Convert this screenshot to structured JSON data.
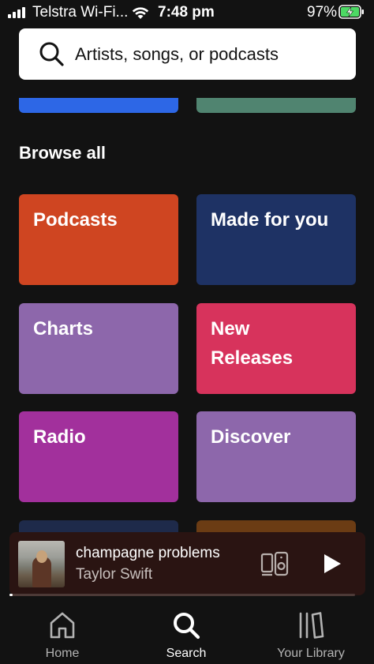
{
  "status_bar": {
    "carrier": "Telstra Wi-Fi...",
    "time": "7:48 pm",
    "battery": "97%"
  },
  "search": {
    "placeholder": "Artists, songs, or podcasts"
  },
  "browse": {
    "title": "Browse all",
    "tiles": [
      {
        "label": "Podcasts",
        "color": "#cf4521"
      },
      {
        "label": "Made for you",
        "color": "#1e3264"
      },
      {
        "label": "Charts",
        "color": "#8d67ab"
      },
      {
        "label": "New Releases",
        "color": "#d7335c"
      },
      {
        "label": "Radio",
        "color": "#a2309c"
      },
      {
        "label": "Discover",
        "color": "#8d67ab"
      }
    ],
    "peek_colors": {
      "left": "#2d67e6",
      "right": "#508470"
    },
    "partial_tile_colors": {
      "left": "#1e2a4a",
      "right": "#6b3c14"
    }
  },
  "now_playing": {
    "title": "champagne problems",
    "artist": "Taylor Swift",
    "progress": 0.01
  },
  "nav": {
    "home": "Home",
    "search": "Search",
    "library": "Your Library",
    "active": "search"
  },
  "colors": {
    "background": "#121212",
    "mini_player": "#2a1412"
  }
}
